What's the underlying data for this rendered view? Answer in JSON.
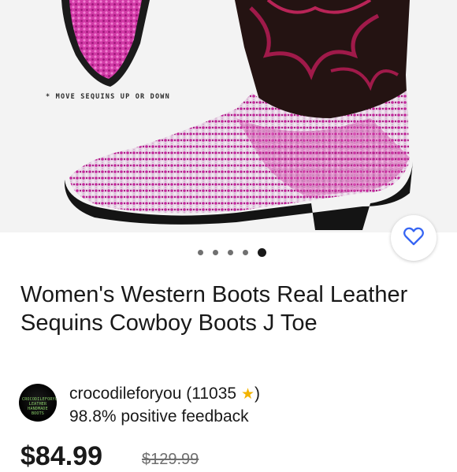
{
  "product_image": {
    "caption": "* MOVE SEQUINS UP OR DOWN",
    "carousel_total": 5,
    "carousel_active": 5
  },
  "favorite": {
    "icon": "heart-outline-icon",
    "color": "#3665f3"
  },
  "listing": {
    "title": "Women's Western Boots Real Leather Sequins Cowboy Boots J Toe"
  },
  "seller": {
    "name": "crocodileforyou",
    "rating_count": "(11035",
    "rating_close": ")",
    "star_icon": "shooting-star-icon",
    "feedback": "98.8% positive feedback",
    "avatar_text": "CROCODILEFORYOU LEATHER HANDMADE BOOTS"
  },
  "price": {
    "current": "$84.99",
    "original": "$129.99"
  }
}
